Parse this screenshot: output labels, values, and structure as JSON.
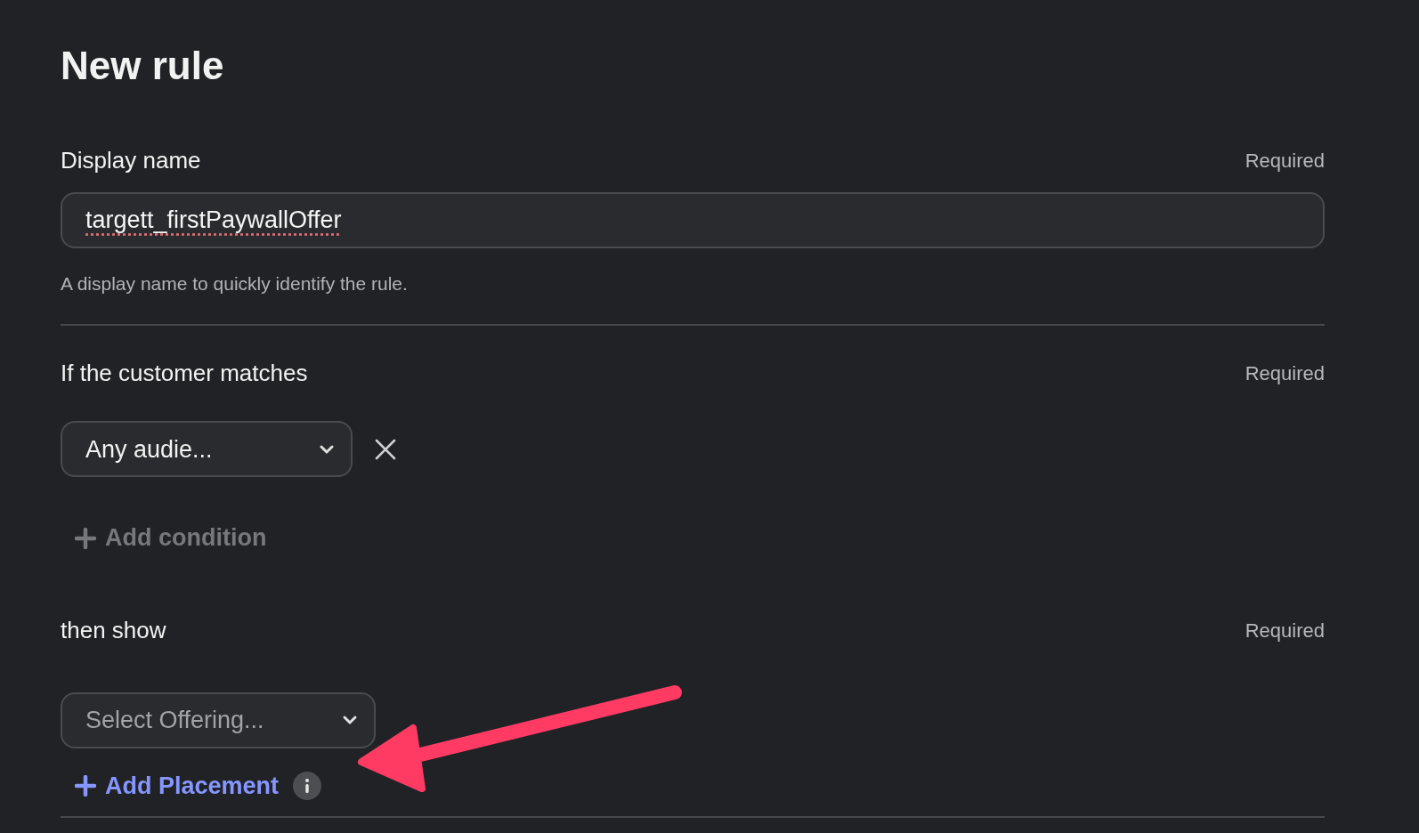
{
  "title": "New rule",
  "display_name": {
    "label": "Display name",
    "required": "Required",
    "value": "targett_firstPaywallOffer",
    "help": "A display name to quickly identify the rule."
  },
  "conditions": {
    "label": "If the customer matches",
    "required": "Required",
    "items": [
      {
        "value": "Any audie..."
      }
    ],
    "add_condition": {
      "label": "Add condition",
      "disabled": true
    }
  },
  "then_show": {
    "label": "then show",
    "required": "Required",
    "offering": {
      "placeholder": "Select Offering..."
    },
    "add_placement": {
      "label": "Add Placement",
      "disabled": false
    }
  }
}
